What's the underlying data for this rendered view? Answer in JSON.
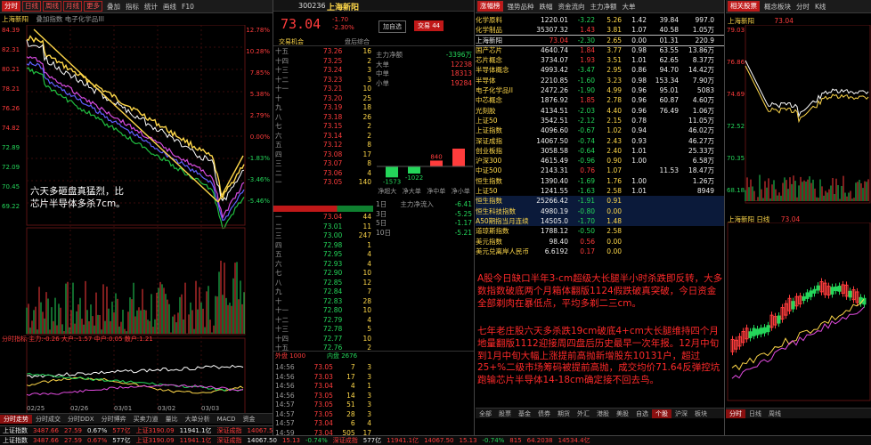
{
  "colors": {
    "up": "#ff3c3c",
    "down": "#24d65a",
    "trend_line": "#ffd84a",
    "bg": "#000000"
  },
  "left": {
    "toolbar": [
      "分时",
      "日线",
      "周线",
      "月线",
      "更多",
      "叠加",
      "指标",
      "统计",
      "画线",
      "F10"
    ],
    "title": "上海新阳",
    "title_extra": "叠加指数 电子化学品III",
    "y_labels": [
      "84.39",
      "82.31",
      "80.21",
      "78.21",
      "76.26",
      "74.82",
      "72.89",
      "72.09",
      "70.45",
      "69.22"
    ],
    "y_right": [
      "12.78%",
      "10.28%",
      "7.85%",
      "5.38%",
      "2.79%",
      "0.00%",
      "-1.83%",
      "-3.46%",
      "-5.46%"
    ],
    "note_line1": "六天多砸盘真猛烈，比",
    "note_line2": "芯片半导体多杀7cm。",
    "vol_labels": [
      "1.44万",
      "1.01万",
      "6000",
      "3000"
    ],
    "macd_label": "分时指标  主力:-0.26  大户:-1.57  中户:0.05  散户:1.21",
    "dates": [
      "02/25",
      "02/26",
      "03/01",
      "03/02",
      "03/03"
    ],
    "bottom_tabs": [
      "分时走势",
      "分时成交",
      "分时DDX",
      "分时博弈",
      "买卖力道",
      "量比",
      "大单分析",
      "MACD",
      "资金"
    ],
    "status": [
      "上证指数",
      "3487.66",
      "27.59",
      "0.67%",
      "577亿",
      "上证3190.09",
      "11941.1亿",
      "深证成指",
      "14067.50",
      "15.13",
      "-0.74%"
    ]
  },
  "mid": {
    "code": "300236",
    "name": "上海新阳",
    "price": "73.04",
    "change": "-1.70",
    "pct": "-2.30%",
    "btn_add": "加自选",
    "btn_buy": "交易 44",
    "tab1": "交易机会",
    "tab2": "盘后综合",
    "bid_ask_hdr": [
      "委比",
      "-29.48%",
      "委差",
      "2228"
    ],
    "sell": [
      [
        "十五",
        "73.26",
        "16"
      ],
      [
        "十四",
        "73.25",
        "2"
      ],
      [
        "十三",
        "73.24",
        "3"
      ],
      [
        "十二",
        "73.23",
        "3"
      ],
      [
        "十一",
        "73.21",
        "10"
      ],
      [
        "十",
        "73.20",
        "25"
      ],
      [
        "九",
        "73.19",
        "18"
      ],
      [
        "八",
        "73.18",
        "26"
      ],
      [
        "七",
        "73.15",
        "2"
      ],
      [
        "六",
        "73.14",
        "2"
      ],
      [
        "五",
        "73.12",
        "8"
      ],
      [
        "四",
        "73.08",
        "17"
      ],
      [
        "三",
        "73.07",
        "8"
      ],
      [
        "二",
        "73.06",
        "4"
      ],
      [
        "一",
        "73.05",
        "140"
      ]
    ],
    "buy": [
      [
        "一",
        "73.04",
        "44"
      ],
      [
        "二",
        "73.01",
        "11"
      ],
      [
        "三",
        "73.00",
        "247"
      ],
      [
        "四",
        "72.98",
        "1"
      ],
      [
        "五",
        "72.95",
        "4"
      ],
      [
        "六",
        "72.93",
        "4"
      ],
      [
        "七",
        "72.90",
        "10"
      ],
      [
        "八",
        "72.85",
        "12"
      ],
      [
        "九",
        "72.84",
        "7"
      ],
      [
        "十",
        "72.83",
        "28"
      ],
      [
        "十一",
        "72.80",
        "10"
      ],
      [
        "十二",
        "72.79",
        "4"
      ],
      [
        "十三",
        "72.78",
        "5"
      ],
      [
        "十四",
        "72.77",
        "10"
      ],
      [
        "十五",
        "72.76",
        "2"
      ]
    ],
    "stats": [
      [
        "主力净额",
        "-3396万"
      ],
      [
        "大单",
        "12238"
      ],
      [
        "中单",
        "18313"
      ],
      [
        "小单",
        "19284"
      ]
    ],
    "flow": [
      "-1573",
      "-1022",
      "840",
      "2555"
    ],
    "flow_labels": [
      "净超大",
      "净大单",
      "净中单",
      "净小单"
    ],
    "period": [
      [
        "1日",
        "主力净流入",
        "-6.41"
      ],
      [
        "3日",
        "",
        "-5.25"
      ],
      [
        "5日",
        "",
        "-1.17"
      ],
      [
        "10日",
        "",
        "-5.21"
      ]
    ],
    "ticks": [
      [
        "14:56",
        "73.05",
        "7",
        "3"
      ],
      [
        "14:56",
        "73.03",
        "17",
        "3"
      ],
      [
        "14:56",
        "73.04",
        "4",
        "1"
      ],
      [
        "14:56",
        "73.05",
        "14",
        "3"
      ],
      [
        "14:57",
        "73.05",
        "51",
        "3"
      ],
      [
        "14:57",
        "73.05",
        "28",
        "3"
      ],
      [
        "14:57",
        "73.04",
        "6",
        "4"
      ],
      [
        "14:59",
        "73.04",
        "505",
        "17"
      ]
    ],
    "out_label": "外盘 1000",
    "in_label": "内盘 2676",
    "total": "70.26"
  },
  "right": {
    "tabs": [
      "涨幅榜",
      "强势品种",
      "跌幅",
      "资金流向",
      "主力净额",
      "大单"
    ],
    "rows": [
      [
        "化学原料",
        "1220.01",
        "-3.22",
        "5.26",
        "1.42",
        "39.84",
        "997.0"
      ],
      [
        "化学制品",
        "35307.32",
        "1.43",
        "3.81",
        "1.07",
        "40.58",
        "1.05万"
      ],
      [
        "上海新阳",
        "73.04",
        "-2.30",
        "2.65",
        "0.00",
        "01.31",
        "220.9"
      ],
      [
        "国产芯片",
        "4640.74",
        "1.84",
        "3.77",
        "0.98",
        "63.55",
        "13.86万"
      ],
      [
        "芯片概念",
        "3734.07",
        "1.93",
        "3.51",
        "1.01",
        "62.65",
        "8.37万"
      ],
      [
        "半导体概念",
        "4993.42",
        "-3.47",
        "2.95",
        "0.86",
        "94.70",
        "14.42万"
      ],
      [
        "半导体",
        "2210.85",
        "-1.60",
        "3.23",
        "0.98",
        "153.34",
        "7.90万"
      ],
      [
        "电子化学品II",
        "2472.26",
        "-1.90",
        "4.99",
        "0.96",
        "95.01",
        "5083"
      ],
      [
        "中芯概念",
        "1876.92",
        "1.85",
        "2.78",
        "0.96",
        "60.87",
        "4.60万"
      ],
      [
        "光刻胶",
        "4134.51",
        "-2.03",
        "4.40",
        "0.96",
        "76.49",
        "1.06万"
      ],
      [
        "上证50",
        "3542.51",
        "-2.12",
        "2.15",
        "0.78",
        "",
        "11.05万"
      ],
      [
        "上证指数",
        "4096.60",
        "-0.67",
        "1.02",
        "0.94",
        "",
        "46.02万"
      ],
      [
        "深证成指",
        "14067.50",
        "-0.74",
        "2.43",
        "0.93",
        "",
        "46.27万"
      ],
      [
        "创业板指",
        "3058.58",
        "-0.64",
        "2.40",
        "1.01",
        "",
        "25.33万"
      ],
      [
        "沪深300",
        "4615.49",
        "-0.96",
        "0.90",
        "1.00",
        "",
        "6.58万"
      ],
      [
        "中证500",
        "2143.31",
        "0.76",
        "1.07",
        "",
        "11.53",
        "18.47万"
      ],
      [
        "恒生指数",
        "1390.40",
        "-1.69",
        "1.76",
        "1.00",
        "",
        "1.26万"
      ],
      [
        "上证50",
        "1241.55",
        "-1.63",
        "2.58",
        "1.01",
        "",
        "8949"
      ],
      [
        "恒生指数",
        "25266.42",
        "-1.91",
        "0.91",
        "",
        "",
        ""
      ],
      [
        "恒生科技指数",
        "4980.19",
        "-0.80",
        "0.00",
        "",
        "",
        ""
      ],
      [
        "A50期指当月连续",
        "14505.0",
        "-1.70",
        "1.48",
        "",
        "",
        ""
      ],
      [
        "道琼斯指数",
        "1788.12",
        "-0.50",
        "2.58",
        "",
        "",
        ""
      ],
      [
        "美元指数",
        "98.40",
        "0.56",
        "0.00",
        "",
        "",
        ""
      ],
      [
        "美元兑离岸人民币",
        "6.6192",
        "0.17",
        "0.00",
        "",
        "",
        ""
      ]
    ],
    "news1": "A股今日缺口半年3-cm超级大长腿半小时杀跌即反转，大多数指数破底两个月箱体翻版1124假跌破真突破，今日资金全部剃肉在暴低点，平均多剃二三cm。",
    "news2": "七年老庄股六天多杀跌19cm破底4+cm大长腿维持四个月地量翻版1112迎接周四盘后历史最早一次年报。12月中旬到1月中旬大幅上涨提前高抛新增股东10131户，超过25+%二级市场筹码被提前高抛，成交均价71.64反弹控坑跑输芯片半导体14-18cm确定接不回去鸟。",
    "bottom_tabs": [
      "全部",
      "股票",
      "基金",
      "债券",
      "期货",
      "外汇",
      "港股",
      "美股",
      "自选",
      "个股",
      "沪深",
      "板块"
    ],
    "status": [
      "深证成指",
      "577亿",
      "11941.1亿",
      "14067.50",
      "15.13",
      "-0.74%"
    ]
  },
  "far": {
    "tabs": [
      "相关股票",
      "概念板块",
      "分时",
      "K线"
    ],
    "title": "上海新阳",
    "price": "73.04",
    "top_ylabels": [
      "79.03",
      "76.86",
      "74.69",
      "72.52",
      "70.35",
      "68.18"
    ],
    "mini_label": "上海新阳 日线",
    "mini_val": "73.04",
    "bottom_tabs": [
      "分时",
      "日线",
      "周线"
    ],
    "status": [
      "815",
      "64.2038",
      "14534.4亿"
    ]
  }
}
